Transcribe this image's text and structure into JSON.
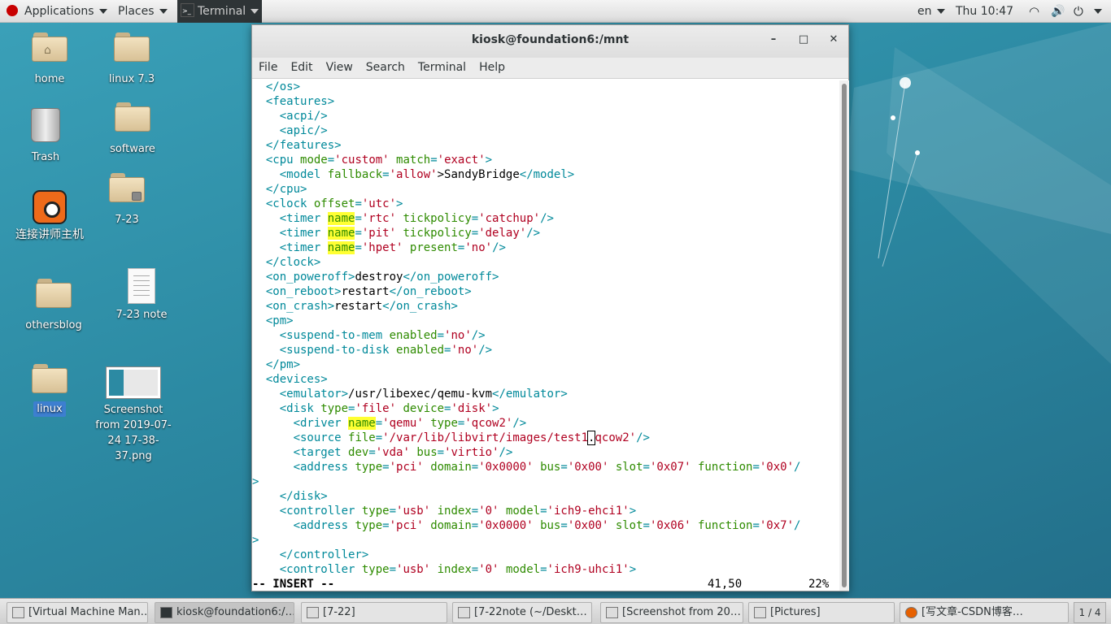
{
  "topbar": {
    "applications": "Applications",
    "places": "Places",
    "terminal": "Terminal",
    "lang": "en",
    "clock": "Thu 10:47"
  },
  "desktop": {
    "icons": [
      {
        "label": "home"
      },
      {
        "label": "linux 7.3"
      },
      {
        "label": "Trash"
      },
      {
        "label": "software"
      },
      {
        "label": "7-23"
      },
      {
        "label": "连接讲师主机"
      },
      {
        "label": "7-23 note"
      },
      {
        "label": "othersblog"
      },
      {
        "label": "linux"
      },
      {
        "label": "Screenshot from 2019-07-24 17-38-37.png"
      }
    ]
  },
  "window": {
    "title": "kiosk@foundation6:/mnt",
    "menu": [
      "File",
      "Edit",
      "View",
      "Search",
      "Terminal",
      "Help"
    ],
    "lines": [
      [
        [
          "t",
          "  </os>"
        ]
      ],
      [
        [
          "t",
          "  <features>"
        ]
      ],
      [
        [
          "t",
          "    <acpi/>"
        ]
      ],
      [
        [
          "t",
          "    <apic/>"
        ]
      ],
      [
        [
          "t",
          "  </features>"
        ]
      ],
      [
        [
          "t",
          "  <cpu "
        ],
        [
          "a",
          "mode"
        ],
        [
          "t",
          "="
        ],
        [
          "v",
          "'custom'"
        ],
        [
          "t",
          " "
        ],
        [
          "a",
          "match"
        ],
        [
          "t",
          "="
        ],
        [
          "v",
          "'exact'"
        ],
        [
          "t",
          ">"
        ]
      ],
      [
        [
          "t",
          "    <model "
        ],
        [
          "a",
          "fallback"
        ],
        [
          "t",
          "="
        ],
        [
          "v",
          "'allow'"
        ],
        [
          "n",
          ">SandyBridge"
        ],
        [
          "t",
          "</model>"
        ]
      ],
      [
        [
          "t",
          "  </cpu>"
        ]
      ],
      [
        [
          "t",
          "  <clock "
        ],
        [
          "a",
          "offset"
        ],
        [
          "t",
          "="
        ],
        [
          "v",
          "'utc'"
        ],
        [
          "t",
          ">"
        ]
      ],
      [
        [
          "t",
          "    <timer "
        ],
        [
          "h",
          "name"
        ],
        [
          "t",
          "="
        ],
        [
          "v",
          "'rtc'"
        ],
        [
          "t",
          " "
        ],
        [
          "a",
          "tickpolicy"
        ],
        [
          "t",
          "="
        ],
        [
          "v",
          "'catchup'"
        ],
        [
          "t",
          "/>"
        ]
      ],
      [
        [
          "t",
          "    <timer "
        ],
        [
          "h",
          "name"
        ],
        [
          "t",
          "="
        ],
        [
          "v",
          "'pit'"
        ],
        [
          "t",
          " "
        ],
        [
          "a",
          "tickpolicy"
        ],
        [
          "t",
          "="
        ],
        [
          "v",
          "'delay'"
        ],
        [
          "t",
          "/>"
        ]
      ],
      [
        [
          "t",
          "    <timer "
        ],
        [
          "h",
          "name"
        ],
        [
          "t",
          "="
        ],
        [
          "v",
          "'hpet'"
        ],
        [
          "t",
          " "
        ],
        [
          "a",
          "present"
        ],
        [
          "t",
          "="
        ],
        [
          "v",
          "'no'"
        ],
        [
          "t",
          "/>"
        ]
      ],
      [
        [
          "t",
          "  </clock>"
        ]
      ],
      [
        [
          "t",
          "  <on_poweroff>"
        ],
        [
          "n",
          "destroy"
        ],
        [
          "t",
          "</on_poweroff>"
        ]
      ],
      [
        [
          "t",
          "  <on_reboot>"
        ],
        [
          "n",
          "restart"
        ],
        [
          "t",
          "</on_reboot>"
        ]
      ],
      [
        [
          "t",
          "  <on_crash>"
        ],
        [
          "n",
          "restart"
        ],
        [
          "t",
          "</on_crash>"
        ]
      ],
      [
        [
          "t",
          "  <pm>"
        ]
      ],
      [
        [
          "t",
          "    <suspend-to-mem "
        ],
        [
          "a",
          "enabled"
        ],
        [
          "t",
          "="
        ],
        [
          "v",
          "'no'"
        ],
        [
          "t",
          "/>"
        ]
      ],
      [
        [
          "t",
          "    <suspend-to-disk "
        ],
        [
          "a",
          "enabled"
        ],
        [
          "t",
          "="
        ],
        [
          "v",
          "'no'"
        ],
        [
          "t",
          "/>"
        ]
      ],
      [
        [
          "t",
          "  </pm>"
        ]
      ],
      [
        [
          "t",
          "  <devices>"
        ]
      ],
      [
        [
          "t",
          "    <emulator>"
        ],
        [
          "n",
          "/usr/libexec/qemu-kvm"
        ],
        [
          "t",
          "</emulator>"
        ]
      ],
      [
        [
          "t",
          "    <disk "
        ],
        [
          "a",
          "type"
        ],
        [
          "t",
          "="
        ],
        [
          "v",
          "'file'"
        ],
        [
          "t",
          " "
        ],
        [
          "a",
          "device"
        ],
        [
          "t",
          "="
        ],
        [
          "v",
          "'disk'"
        ],
        [
          "t",
          ">"
        ]
      ],
      [
        [
          "t",
          "      <driver "
        ],
        [
          "h",
          "name"
        ],
        [
          "t",
          "="
        ],
        [
          "v",
          "'qemu'"
        ],
        [
          "t",
          " "
        ],
        [
          "a",
          "type"
        ],
        [
          "t",
          "="
        ],
        [
          "v",
          "'qcow2'"
        ],
        [
          "t",
          "/>"
        ]
      ],
      [
        [
          "t",
          "      <source "
        ],
        [
          "a",
          "file"
        ],
        [
          "t",
          "="
        ],
        [
          "v",
          "'/var/lib/libvirt/images/test1"
        ],
        [
          "c",
          "."
        ],
        [
          "v",
          "qcow2'"
        ],
        [
          "t",
          "/>"
        ]
      ],
      [
        [
          "t",
          "      <target "
        ],
        [
          "a",
          "dev"
        ],
        [
          "t",
          "="
        ],
        [
          "v",
          "'vda'"
        ],
        [
          "t",
          " "
        ],
        [
          "a",
          "bus"
        ],
        [
          "t",
          "="
        ],
        [
          "v",
          "'virtio'"
        ],
        [
          "t",
          "/>"
        ]
      ],
      [
        [
          "t",
          "      <address "
        ],
        [
          "a",
          "type"
        ],
        [
          "t",
          "="
        ],
        [
          "v",
          "'pci'"
        ],
        [
          "t",
          " "
        ],
        [
          "a",
          "domain"
        ],
        [
          "t",
          "="
        ],
        [
          "v",
          "'0x0000'"
        ],
        [
          "t",
          " "
        ],
        [
          "a",
          "bus"
        ],
        [
          "t",
          "="
        ],
        [
          "v",
          "'0x00'"
        ],
        [
          "t",
          " "
        ],
        [
          "a",
          "slot"
        ],
        [
          "t",
          "="
        ],
        [
          "v",
          "'0x07'"
        ],
        [
          "t",
          " "
        ],
        [
          "a",
          "function"
        ],
        [
          "t",
          "="
        ],
        [
          "v",
          "'0x0'"
        ],
        [
          "t",
          "/"
        ]
      ],
      [
        [
          "t",
          ">"
        ]
      ],
      [
        [
          "t",
          "    </disk>"
        ]
      ],
      [
        [
          "t",
          "    <controller "
        ],
        [
          "a",
          "type"
        ],
        [
          "t",
          "="
        ],
        [
          "v",
          "'usb'"
        ],
        [
          "t",
          " "
        ],
        [
          "a",
          "index"
        ],
        [
          "t",
          "="
        ],
        [
          "v",
          "'0'"
        ],
        [
          "t",
          " "
        ],
        [
          "a",
          "model"
        ],
        [
          "t",
          "="
        ],
        [
          "v",
          "'ich9-ehci1'"
        ],
        [
          "t",
          ">"
        ]
      ],
      [
        [
          "t",
          "      <address "
        ],
        [
          "a",
          "type"
        ],
        [
          "t",
          "="
        ],
        [
          "v",
          "'pci'"
        ],
        [
          "t",
          " "
        ],
        [
          "a",
          "domain"
        ],
        [
          "t",
          "="
        ],
        [
          "v",
          "'0x0000'"
        ],
        [
          "t",
          " "
        ],
        [
          "a",
          "bus"
        ],
        [
          "t",
          "="
        ],
        [
          "v",
          "'0x00'"
        ],
        [
          "t",
          " "
        ],
        [
          "a",
          "slot"
        ],
        [
          "t",
          "="
        ],
        [
          "v",
          "'0x06'"
        ],
        [
          "t",
          " "
        ],
        [
          "a",
          "function"
        ],
        [
          "t",
          "="
        ],
        [
          "v",
          "'0x7'"
        ],
        [
          "t",
          "/"
        ]
      ],
      [
        [
          "t",
          ">"
        ]
      ],
      [
        [
          "t",
          "    </controller>"
        ]
      ],
      [
        [
          "t",
          "    <controller "
        ],
        [
          "a",
          "type"
        ],
        [
          "t",
          "="
        ],
        [
          "v",
          "'usb'"
        ],
        [
          "t",
          " "
        ],
        [
          "a",
          "index"
        ],
        [
          "t",
          "="
        ],
        [
          "v",
          "'0'"
        ],
        [
          "t",
          " "
        ],
        [
          "a",
          "model"
        ],
        [
          "t",
          "="
        ],
        [
          "v",
          "'ich9-uhci1'"
        ],
        [
          "t",
          ">"
        ]
      ]
    ],
    "status_mode": "-- INSERT --",
    "status_pos": "41,50",
    "status_pct": "22%",
    "scroll_fraction": 0.22
  },
  "taskbar": {
    "tasks": [
      "[Virtual Machine Man…",
      "kiosk@foundation6:/…",
      "[7-22]",
      "[7-22note (~/Deskt…",
      "[Screenshot from 20…",
      "[Pictures]",
      "[写文章-CSDN博客…"
    ],
    "pager": "1 / 4"
  },
  "colors": {
    "tag": "#00899a",
    "attr": "#2e8b00",
    "value": "#b00020",
    "highlight": "#ffff33"
  }
}
